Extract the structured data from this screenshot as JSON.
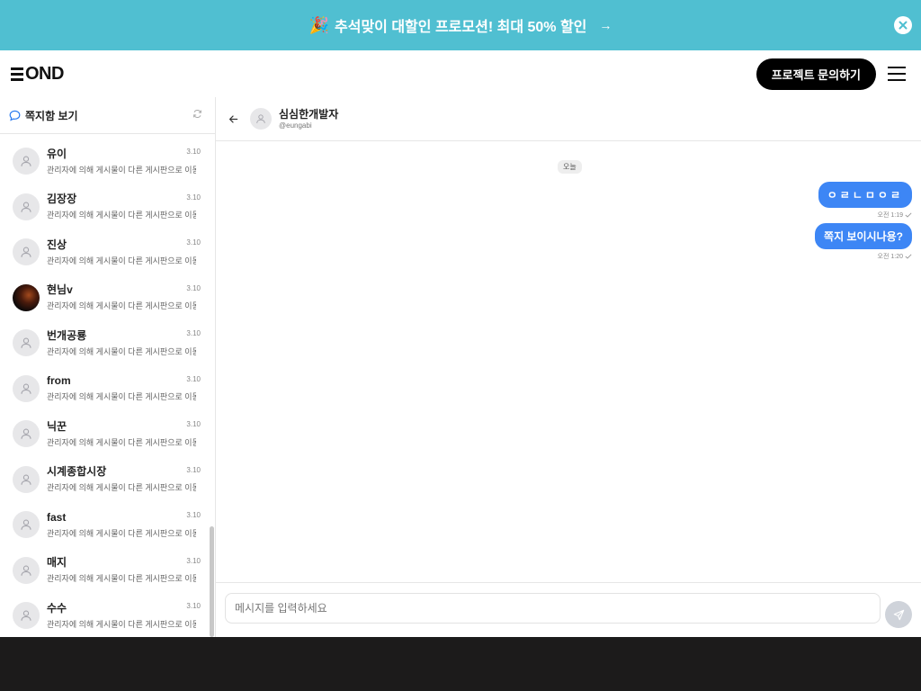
{
  "promo": {
    "emoji": "🎉",
    "text": "추석맞이 대할인 프로모션! 최대 50% 할인",
    "arrow": "→"
  },
  "brand": {
    "logo_text": "OND"
  },
  "nav": {
    "cta_label": "프로젝트 문의하기"
  },
  "sidebar": {
    "title": "쪽지함 보기",
    "conversations": [
      {
        "name": "유이",
        "preview": "관리자에 의해 게시물이 다른 게시판으로 이동되...",
        "date": "3.10"
      },
      {
        "name": "김장장",
        "preview": "관리자에 의해 게시물이 다른 게시판으로 이동되...",
        "date": "3.10"
      },
      {
        "name": "진상",
        "preview": "관리자에 의해 게시물이 다른 게시판으로 이동되...",
        "date": "3.10"
      },
      {
        "name": "현님v",
        "preview": "관리자에 의해 게시물이 다른 게시판으로 이동되...",
        "date": "3.10"
      },
      {
        "name": "번개공룡",
        "preview": "관리자에 의해 게시물이 다른 게시판으로 이동되...",
        "date": "3.10"
      },
      {
        "name": "from",
        "preview": "관리자에 의해 게시물이 다른 게시판으로 이동되...",
        "date": "3.10"
      },
      {
        "name": "닉꾼",
        "preview": "관리자에 의해 게시물이 다른 게시판으로 이동되...",
        "date": "3.10"
      },
      {
        "name": "시계종합시장",
        "preview": "관리자에 의해 게시물이 다른 게시판으로 이동되...",
        "date": "3.10"
      },
      {
        "name": "fast",
        "preview": "관리자에 의해 게시물이 다른 게시판으로 이동되...",
        "date": "3.10"
      },
      {
        "name": "매지",
        "preview": "관리자에 의해 게시물이 다른 게시판으로 이동되...",
        "date": "3.10"
      },
      {
        "name": "수수",
        "preview": "관리자에 의해 게시물이 다른 게시판으로 이동되...",
        "date": "3.10"
      }
    ]
  },
  "chat": {
    "user_name": "심심한개발자",
    "user_handle": "@eungabi",
    "date_divider": "오늘",
    "messages": [
      {
        "text": "ㅇㄹㄴㅁㅇㄹ",
        "time": "오전 1:19"
      },
      {
        "text": "쪽지 보이시나용?",
        "time": "오전 1:20"
      }
    ],
    "input_placeholder": "메시지를 입력하세요"
  },
  "colors": {
    "promo_bg": "#50bfd1",
    "bubble_bg": "#3d86f5",
    "cta_bg": "#000000"
  }
}
